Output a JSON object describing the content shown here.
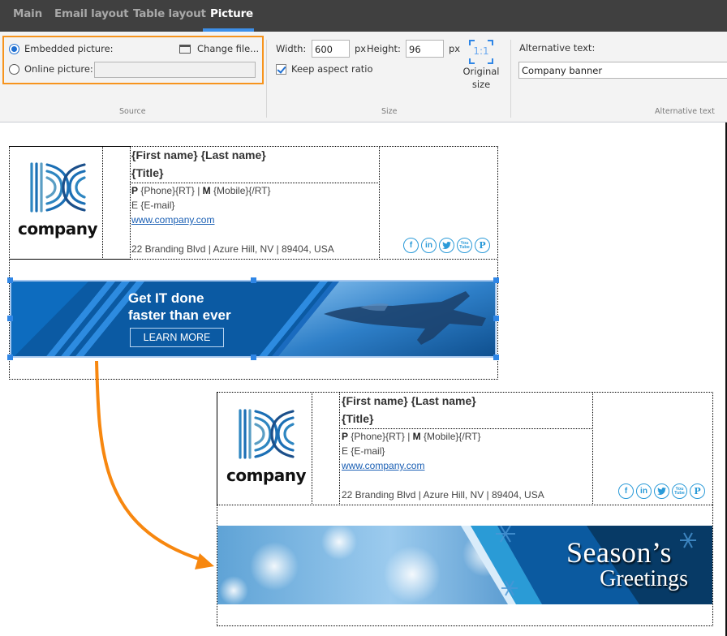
{
  "tabs": [
    {
      "label": "Main",
      "active": false
    },
    {
      "label": "Email layout",
      "active": false
    },
    {
      "label": "Table layout",
      "active": false
    },
    {
      "label": "Picture",
      "active": true
    }
  ],
  "ribbon": {
    "source": {
      "group_label": "Source",
      "embedded_label": "Embedded picture:",
      "embedded_selected": true,
      "online_label": "Online picture:",
      "online_selected": false,
      "online_value": "",
      "change_file_label": "Change file..."
    },
    "size": {
      "group_label": "Size",
      "width_label": "Width:",
      "width_value": "600",
      "unit1": "px",
      "height_label": "Height:",
      "height_value": "96",
      "unit2": "px",
      "keep_aspect_label": "Keep aspect ratio",
      "keep_aspect_checked": true,
      "original_icon_text": "1:1",
      "original_label_line1": "Original",
      "original_label_line2": "size"
    },
    "alt": {
      "group_label": "Alternative text",
      "label": "Alternative text:",
      "value": "Company banner"
    }
  },
  "signature": {
    "logo_word": "company",
    "name": "{First name} {Last name}",
    "title": "{Title}",
    "phone_prefix": "P",
    "phone": "{Phone}{RT} |",
    "mobile_prefix": "M",
    "mobile": "{Mobile}{/RT}",
    "email_prefix": "E",
    "email": "{E-mail}",
    "website": "www.company.com",
    "address": "22 Branding Blvd | Azure Hill, NV | 89404, USA",
    "social": [
      {
        "icon": "facebook-icon",
        "glyph": "f"
      },
      {
        "icon": "linkedin-icon",
        "glyph": "in"
      },
      {
        "icon": "twitter-icon",
        "glyph": "🐦"
      },
      {
        "icon": "youtube-icon",
        "glyph": "You\nTube"
      },
      {
        "icon": "pinterest-icon",
        "glyph": "P"
      }
    ]
  },
  "banner_before": {
    "headline1": "Get IT done",
    "headline2": "faster than ever",
    "button": "LEARN MORE"
  },
  "banner_after": {
    "title": "Season’s",
    "subtitle": "Greetings"
  },
  "colors": {
    "accent": "#3d8fe8",
    "highlight": "#f7941d",
    "social": "#2a9ad8"
  }
}
